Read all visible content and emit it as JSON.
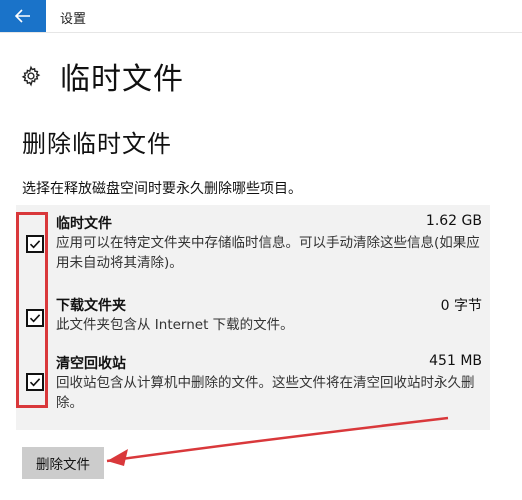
{
  "window": {
    "title": "设置"
  },
  "header": {
    "title": "临时文件"
  },
  "section": {
    "title": "删除临时文件",
    "description": "选择在释放磁盘空间时要永久删除哪些项目。"
  },
  "items": [
    {
      "name": "临时文件",
      "size": "1.62 GB",
      "description": "应用可以在特定文件夹中存储临时信息。可以手动清除这些信息(如果应用未自动将其清除)。",
      "checked": true
    },
    {
      "name": "下载文件夹",
      "size": "0 字节",
      "description": "此文件夹包含从 Internet 下载的文件。",
      "checked": true
    },
    {
      "name": "清空回收站",
      "size": "451 MB",
      "description": "回收站包含从计算机中删除的文件。这些文件将在清空回收站时永久删除。",
      "checked": true
    }
  ],
  "actions": {
    "delete_label": "删除文件"
  },
  "colors": {
    "accent": "#1a73c9",
    "annotation": "#d9383b"
  }
}
